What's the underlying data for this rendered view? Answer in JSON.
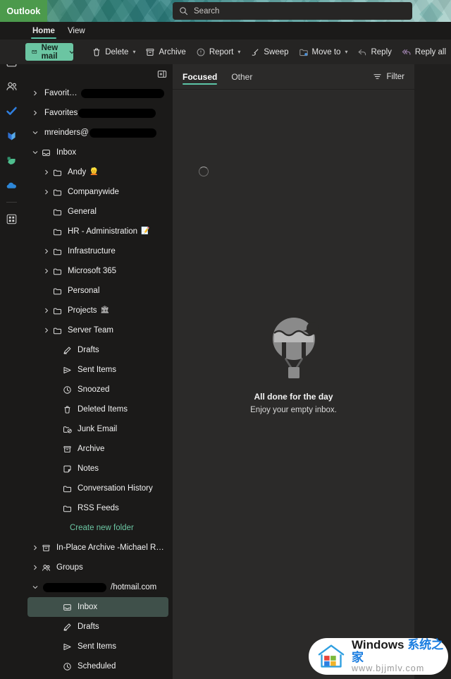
{
  "window": {
    "brand": "Outlook",
    "search_placeholder": "Search"
  },
  "ribbon": {
    "tabs": [
      {
        "label": "Home",
        "active": true
      },
      {
        "label": "View",
        "active": false
      }
    ]
  },
  "commandbar": {
    "new_mail": "New mail",
    "commands": [
      {
        "label": "Delete",
        "icon": "trash-icon",
        "caret": true
      },
      {
        "label": "Archive",
        "icon": "archive-icon",
        "caret": false
      },
      {
        "label": "Report",
        "icon": "report-icon",
        "caret": true
      },
      {
        "label": "Sweep",
        "icon": "sweep-icon",
        "caret": false
      },
      {
        "label": "Move to",
        "icon": "move-to-icon",
        "caret": true
      },
      {
        "label": "Reply",
        "icon": "reply-icon",
        "caret": false
      },
      {
        "label": "Reply all",
        "icon": "reply-all-icon",
        "caret": false
      }
    ]
  },
  "rail": {
    "items": [
      {
        "name": "mail",
        "selected": true
      },
      {
        "name": "calendar",
        "selected": false
      },
      {
        "name": "people",
        "selected": false
      },
      {
        "name": "todo",
        "selected": false
      },
      {
        "name": "viva-engage",
        "selected": false
      },
      {
        "name": "bookings",
        "selected": false
      },
      {
        "name": "onedrive",
        "selected": false
      },
      {
        "name": "apps",
        "selected": false
      }
    ]
  },
  "folderpane": {
    "folders": [
      {
        "label": "Favorites (",
        "icon": "none",
        "chevron": "right",
        "indent": "lvl0",
        "redact": 118
      },
      {
        "label": "Favorites",
        "icon": "none",
        "chevron": "right",
        "indent": "lvl0",
        "redact": 110
      },
      {
        "label": "mreinders@",
        "icon": "none",
        "chevron": "down",
        "indent": "lvl0",
        "redact": 95
      },
      {
        "label": "Inbox",
        "icon": "inbox-icon",
        "chevron": "down",
        "indent": "lvl1"
      },
      {
        "label": "Andy",
        "icon": "folder-icon",
        "chevron": "right",
        "indent": "lvl2",
        "emoji": "👱"
      },
      {
        "label": "Companywide",
        "icon": "folder-icon",
        "chevron": "right",
        "indent": "lvl2"
      },
      {
        "label": "General",
        "icon": "folder-icon",
        "chevron": "none",
        "indent": "lvl2"
      },
      {
        "label": "HR - Administration",
        "icon": "folder-icon",
        "chevron": "none",
        "indent": "lvl2",
        "emoji": "📝"
      },
      {
        "label": "Infrastructure",
        "icon": "folder-icon",
        "chevron": "right",
        "indent": "lvl2"
      },
      {
        "label": "Microsoft 365",
        "icon": "folder-icon",
        "chevron": "right",
        "indent": "lvl2"
      },
      {
        "label": "Personal",
        "icon": "folder-icon",
        "chevron": "none",
        "indent": "lvl2"
      },
      {
        "label": "Projects",
        "icon": "folder-icon",
        "chevron": "right",
        "indent": "lvl2",
        "emoji": "🏛"
      },
      {
        "label": "Server Team",
        "icon": "folder-icon",
        "chevron": "right",
        "indent": "lvl2"
      },
      {
        "label": "Drafts",
        "icon": "drafts-icon",
        "chevron": "none",
        "indent": "lvl2b"
      },
      {
        "label": "Sent Items",
        "icon": "sent-icon",
        "chevron": "none",
        "indent": "lvl2b"
      },
      {
        "label": "Snoozed",
        "icon": "clock-icon",
        "chevron": "none",
        "indent": "lvl2b"
      },
      {
        "label": "Deleted Items",
        "icon": "trash-icon",
        "chevron": "none",
        "indent": "lvl2b"
      },
      {
        "label": "Junk Email",
        "icon": "junk-icon",
        "chevron": "none",
        "indent": "lvl2b"
      },
      {
        "label": "Archive",
        "icon": "archive-icon",
        "chevron": "none",
        "indent": "lvl2b"
      },
      {
        "label": "Notes",
        "icon": "notes-icon",
        "chevron": "none",
        "indent": "lvl2b"
      },
      {
        "label": "Conversation History",
        "icon": "folder-icon",
        "chevron": "none",
        "indent": "lvl2b"
      },
      {
        "label": "RSS Feeds",
        "icon": "folder-icon",
        "chevron": "none",
        "indent": "lvl2b"
      },
      {
        "label": "Create new folder",
        "icon": "none",
        "chevron": "none",
        "indent": "lvl3",
        "link": true
      },
      {
        "label": "In-Place Archive -Michael Rei...",
        "icon": "archive-icon",
        "chevron": "right",
        "indent": "lvl0"
      },
      {
        "label": "Groups",
        "icon": "groups-icon",
        "chevron": "right",
        "indent": "lvl0"
      },
      {
        "label": "/hotmail.com",
        "icon": "none",
        "chevron": "down",
        "indent": "lvl0",
        "redact": 90,
        "redact_before": true
      },
      {
        "label": "Inbox",
        "icon": "inbox-icon",
        "chevron": "none",
        "indent": "lvl2b",
        "selected": true
      },
      {
        "label": "Drafts",
        "icon": "drafts-icon",
        "chevron": "none",
        "indent": "lvl2b"
      },
      {
        "label": "Sent Items",
        "icon": "sent-icon",
        "chevron": "none",
        "indent": "lvl2b"
      },
      {
        "label": "Scheduled",
        "icon": "clock-icon",
        "chevron": "none",
        "indent": "lvl2b"
      }
    ]
  },
  "messagelist": {
    "pivots": [
      {
        "label": "Focused",
        "active": true
      },
      {
        "label": "Other",
        "active": false
      }
    ],
    "filter_label": "Filter",
    "empty_title": "All done for the day",
    "empty_subtitle": "Enjoy your empty inbox."
  },
  "watermark": {
    "line1_en": "Windows ",
    "line1_cn": "系统之家",
    "line2": "www.bjjmlv.com"
  },
  "colors": {
    "accent": "#6bc5a2",
    "banner_green": "#4c9a4c",
    "selected_folder": "#3f504a",
    "app_bg": "#1b1a19",
    "list_bg": "#2b2a29",
    "reading_bg": "#201f1e"
  }
}
